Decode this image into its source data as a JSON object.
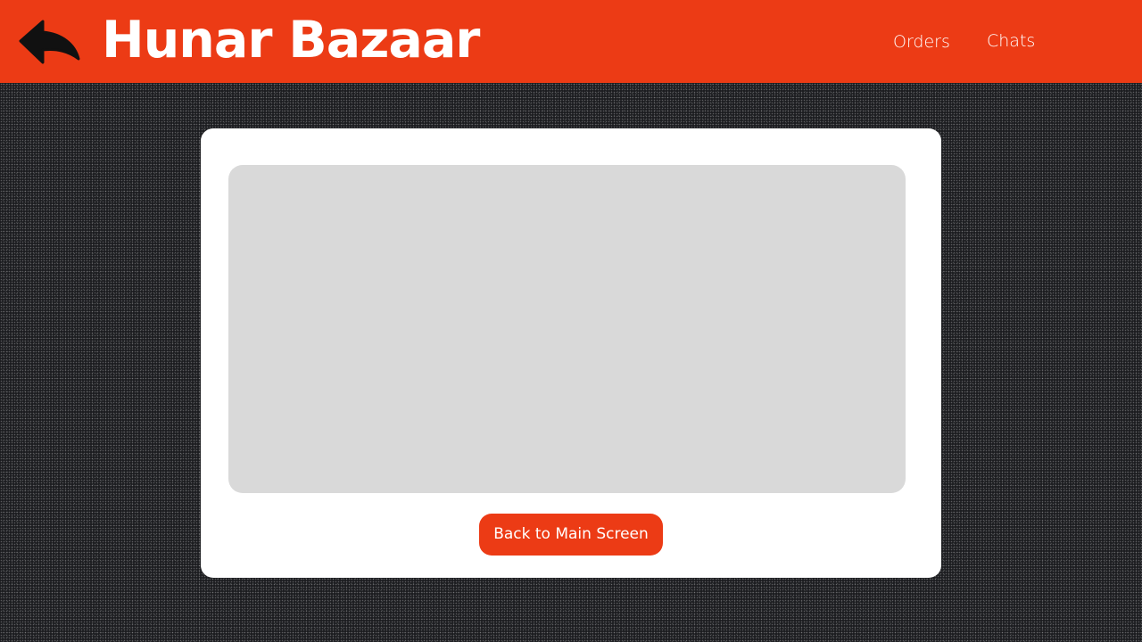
{
  "header": {
    "back_icon": "back-arrow-icon",
    "brand_title": "Hunar Bazaar",
    "nav": [
      {
        "label": "Orders"
      },
      {
        "label": "Chats"
      }
    ]
  },
  "content": {
    "back_button_label": "Back to Main Screen"
  },
  "colors": {
    "accent": "#ec3b15",
    "placeholder": "#d9d9d9",
    "card": "#ffffff",
    "background": "#1c1d20"
  }
}
